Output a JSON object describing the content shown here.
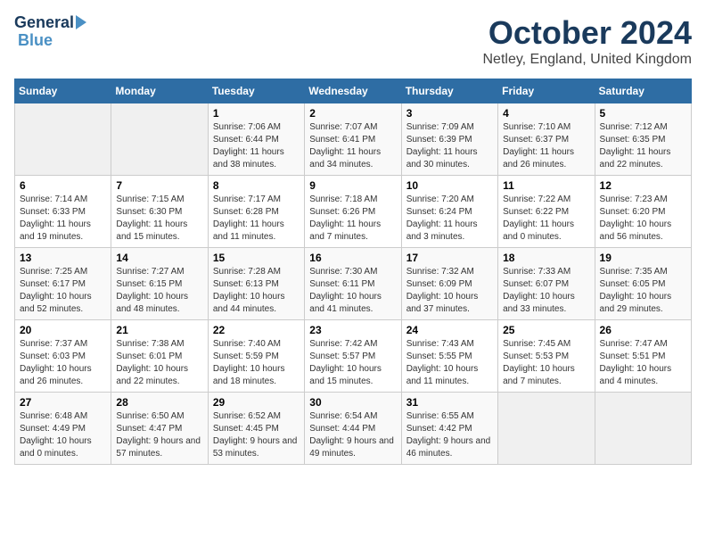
{
  "header": {
    "logo_line1": "General",
    "logo_line2": "Blue",
    "month": "October 2024",
    "location": "Netley, England, United Kingdom"
  },
  "days_of_week": [
    "Sunday",
    "Monday",
    "Tuesday",
    "Wednesday",
    "Thursday",
    "Friday",
    "Saturday"
  ],
  "weeks": [
    [
      {
        "day": "",
        "content": ""
      },
      {
        "day": "",
        "content": ""
      },
      {
        "day": "1",
        "content": "Sunrise: 7:06 AM\nSunset: 6:44 PM\nDaylight: 11 hours and 38 minutes."
      },
      {
        "day": "2",
        "content": "Sunrise: 7:07 AM\nSunset: 6:41 PM\nDaylight: 11 hours and 34 minutes."
      },
      {
        "day": "3",
        "content": "Sunrise: 7:09 AM\nSunset: 6:39 PM\nDaylight: 11 hours and 30 minutes."
      },
      {
        "day": "4",
        "content": "Sunrise: 7:10 AM\nSunset: 6:37 PM\nDaylight: 11 hours and 26 minutes."
      },
      {
        "day": "5",
        "content": "Sunrise: 7:12 AM\nSunset: 6:35 PM\nDaylight: 11 hours and 22 minutes."
      }
    ],
    [
      {
        "day": "6",
        "content": "Sunrise: 7:14 AM\nSunset: 6:33 PM\nDaylight: 11 hours and 19 minutes."
      },
      {
        "day": "7",
        "content": "Sunrise: 7:15 AM\nSunset: 6:30 PM\nDaylight: 11 hours and 15 minutes."
      },
      {
        "day": "8",
        "content": "Sunrise: 7:17 AM\nSunset: 6:28 PM\nDaylight: 11 hours and 11 minutes."
      },
      {
        "day": "9",
        "content": "Sunrise: 7:18 AM\nSunset: 6:26 PM\nDaylight: 11 hours and 7 minutes."
      },
      {
        "day": "10",
        "content": "Sunrise: 7:20 AM\nSunset: 6:24 PM\nDaylight: 11 hours and 3 minutes."
      },
      {
        "day": "11",
        "content": "Sunrise: 7:22 AM\nSunset: 6:22 PM\nDaylight: 11 hours and 0 minutes."
      },
      {
        "day": "12",
        "content": "Sunrise: 7:23 AM\nSunset: 6:20 PM\nDaylight: 10 hours and 56 minutes."
      }
    ],
    [
      {
        "day": "13",
        "content": "Sunrise: 7:25 AM\nSunset: 6:17 PM\nDaylight: 10 hours and 52 minutes."
      },
      {
        "day": "14",
        "content": "Sunrise: 7:27 AM\nSunset: 6:15 PM\nDaylight: 10 hours and 48 minutes."
      },
      {
        "day": "15",
        "content": "Sunrise: 7:28 AM\nSunset: 6:13 PM\nDaylight: 10 hours and 44 minutes."
      },
      {
        "day": "16",
        "content": "Sunrise: 7:30 AM\nSunset: 6:11 PM\nDaylight: 10 hours and 41 minutes."
      },
      {
        "day": "17",
        "content": "Sunrise: 7:32 AM\nSunset: 6:09 PM\nDaylight: 10 hours and 37 minutes."
      },
      {
        "day": "18",
        "content": "Sunrise: 7:33 AM\nSunset: 6:07 PM\nDaylight: 10 hours and 33 minutes."
      },
      {
        "day": "19",
        "content": "Sunrise: 7:35 AM\nSunset: 6:05 PM\nDaylight: 10 hours and 29 minutes."
      }
    ],
    [
      {
        "day": "20",
        "content": "Sunrise: 7:37 AM\nSunset: 6:03 PM\nDaylight: 10 hours and 26 minutes."
      },
      {
        "day": "21",
        "content": "Sunrise: 7:38 AM\nSunset: 6:01 PM\nDaylight: 10 hours and 22 minutes."
      },
      {
        "day": "22",
        "content": "Sunrise: 7:40 AM\nSunset: 5:59 PM\nDaylight: 10 hours and 18 minutes."
      },
      {
        "day": "23",
        "content": "Sunrise: 7:42 AM\nSunset: 5:57 PM\nDaylight: 10 hours and 15 minutes."
      },
      {
        "day": "24",
        "content": "Sunrise: 7:43 AM\nSunset: 5:55 PM\nDaylight: 10 hours and 11 minutes."
      },
      {
        "day": "25",
        "content": "Sunrise: 7:45 AM\nSunset: 5:53 PM\nDaylight: 10 hours and 7 minutes."
      },
      {
        "day": "26",
        "content": "Sunrise: 7:47 AM\nSunset: 5:51 PM\nDaylight: 10 hours and 4 minutes."
      }
    ],
    [
      {
        "day": "27",
        "content": "Sunrise: 6:48 AM\nSunset: 4:49 PM\nDaylight: 10 hours and 0 minutes."
      },
      {
        "day": "28",
        "content": "Sunrise: 6:50 AM\nSunset: 4:47 PM\nDaylight: 9 hours and 57 minutes."
      },
      {
        "day": "29",
        "content": "Sunrise: 6:52 AM\nSunset: 4:45 PM\nDaylight: 9 hours and 53 minutes."
      },
      {
        "day": "30",
        "content": "Sunrise: 6:54 AM\nSunset: 4:44 PM\nDaylight: 9 hours and 49 minutes."
      },
      {
        "day": "31",
        "content": "Sunrise: 6:55 AM\nSunset: 4:42 PM\nDaylight: 9 hours and 46 minutes."
      },
      {
        "day": "",
        "content": ""
      },
      {
        "day": "",
        "content": ""
      }
    ]
  ]
}
